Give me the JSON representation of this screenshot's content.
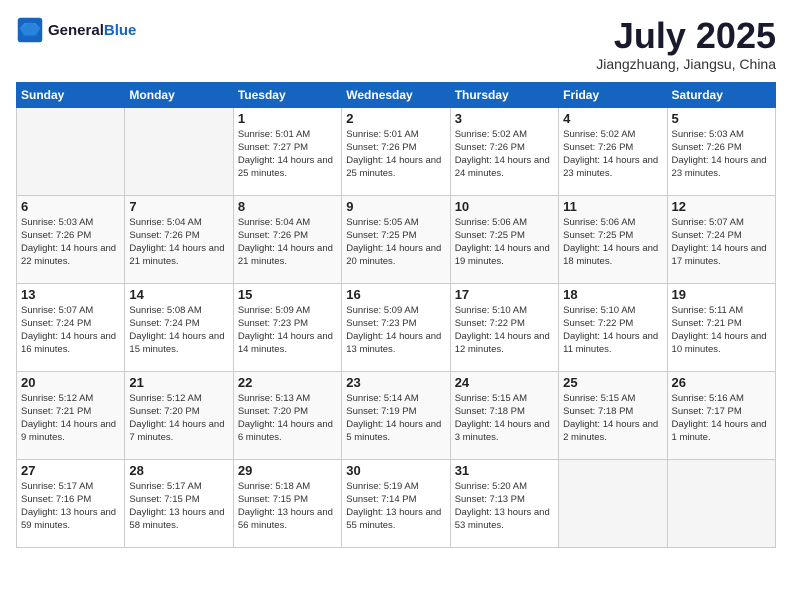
{
  "header": {
    "logo_line1": "General",
    "logo_line2": "Blue",
    "month": "July 2025",
    "location": "Jiangzhuang, Jiangsu, China"
  },
  "weekdays": [
    "Sunday",
    "Monday",
    "Tuesday",
    "Wednesday",
    "Thursday",
    "Friday",
    "Saturday"
  ],
  "weeks": [
    [
      {
        "day": "",
        "info": ""
      },
      {
        "day": "",
        "info": ""
      },
      {
        "day": "1",
        "info": "Sunrise: 5:01 AM\nSunset: 7:27 PM\nDaylight: 14 hours and 25 minutes."
      },
      {
        "day": "2",
        "info": "Sunrise: 5:01 AM\nSunset: 7:26 PM\nDaylight: 14 hours and 25 minutes."
      },
      {
        "day": "3",
        "info": "Sunrise: 5:02 AM\nSunset: 7:26 PM\nDaylight: 14 hours and 24 minutes."
      },
      {
        "day": "4",
        "info": "Sunrise: 5:02 AM\nSunset: 7:26 PM\nDaylight: 14 hours and 23 minutes."
      },
      {
        "day": "5",
        "info": "Sunrise: 5:03 AM\nSunset: 7:26 PM\nDaylight: 14 hours and 23 minutes."
      }
    ],
    [
      {
        "day": "6",
        "info": "Sunrise: 5:03 AM\nSunset: 7:26 PM\nDaylight: 14 hours and 22 minutes."
      },
      {
        "day": "7",
        "info": "Sunrise: 5:04 AM\nSunset: 7:26 PM\nDaylight: 14 hours and 21 minutes."
      },
      {
        "day": "8",
        "info": "Sunrise: 5:04 AM\nSunset: 7:26 PM\nDaylight: 14 hours and 21 minutes."
      },
      {
        "day": "9",
        "info": "Sunrise: 5:05 AM\nSunset: 7:25 PM\nDaylight: 14 hours and 20 minutes."
      },
      {
        "day": "10",
        "info": "Sunrise: 5:06 AM\nSunset: 7:25 PM\nDaylight: 14 hours and 19 minutes."
      },
      {
        "day": "11",
        "info": "Sunrise: 5:06 AM\nSunset: 7:25 PM\nDaylight: 14 hours and 18 minutes."
      },
      {
        "day": "12",
        "info": "Sunrise: 5:07 AM\nSunset: 7:24 PM\nDaylight: 14 hours and 17 minutes."
      }
    ],
    [
      {
        "day": "13",
        "info": "Sunrise: 5:07 AM\nSunset: 7:24 PM\nDaylight: 14 hours and 16 minutes."
      },
      {
        "day": "14",
        "info": "Sunrise: 5:08 AM\nSunset: 7:24 PM\nDaylight: 14 hours and 15 minutes."
      },
      {
        "day": "15",
        "info": "Sunrise: 5:09 AM\nSunset: 7:23 PM\nDaylight: 14 hours and 14 minutes."
      },
      {
        "day": "16",
        "info": "Sunrise: 5:09 AM\nSunset: 7:23 PM\nDaylight: 14 hours and 13 minutes."
      },
      {
        "day": "17",
        "info": "Sunrise: 5:10 AM\nSunset: 7:22 PM\nDaylight: 14 hours and 12 minutes."
      },
      {
        "day": "18",
        "info": "Sunrise: 5:10 AM\nSunset: 7:22 PM\nDaylight: 14 hours and 11 minutes."
      },
      {
        "day": "19",
        "info": "Sunrise: 5:11 AM\nSunset: 7:21 PM\nDaylight: 14 hours and 10 minutes."
      }
    ],
    [
      {
        "day": "20",
        "info": "Sunrise: 5:12 AM\nSunset: 7:21 PM\nDaylight: 14 hours and 9 minutes."
      },
      {
        "day": "21",
        "info": "Sunrise: 5:12 AM\nSunset: 7:20 PM\nDaylight: 14 hours and 7 minutes."
      },
      {
        "day": "22",
        "info": "Sunrise: 5:13 AM\nSunset: 7:20 PM\nDaylight: 14 hours and 6 minutes."
      },
      {
        "day": "23",
        "info": "Sunrise: 5:14 AM\nSunset: 7:19 PM\nDaylight: 14 hours and 5 minutes."
      },
      {
        "day": "24",
        "info": "Sunrise: 5:15 AM\nSunset: 7:18 PM\nDaylight: 14 hours and 3 minutes."
      },
      {
        "day": "25",
        "info": "Sunrise: 5:15 AM\nSunset: 7:18 PM\nDaylight: 14 hours and 2 minutes."
      },
      {
        "day": "26",
        "info": "Sunrise: 5:16 AM\nSunset: 7:17 PM\nDaylight: 14 hours and 1 minute."
      }
    ],
    [
      {
        "day": "27",
        "info": "Sunrise: 5:17 AM\nSunset: 7:16 PM\nDaylight: 13 hours and 59 minutes."
      },
      {
        "day": "28",
        "info": "Sunrise: 5:17 AM\nSunset: 7:15 PM\nDaylight: 13 hours and 58 minutes."
      },
      {
        "day": "29",
        "info": "Sunrise: 5:18 AM\nSunset: 7:15 PM\nDaylight: 13 hours and 56 minutes."
      },
      {
        "day": "30",
        "info": "Sunrise: 5:19 AM\nSunset: 7:14 PM\nDaylight: 13 hours and 55 minutes."
      },
      {
        "day": "31",
        "info": "Sunrise: 5:20 AM\nSunset: 7:13 PM\nDaylight: 13 hours and 53 minutes."
      },
      {
        "day": "",
        "info": ""
      },
      {
        "day": "",
        "info": ""
      }
    ]
  ]
}
